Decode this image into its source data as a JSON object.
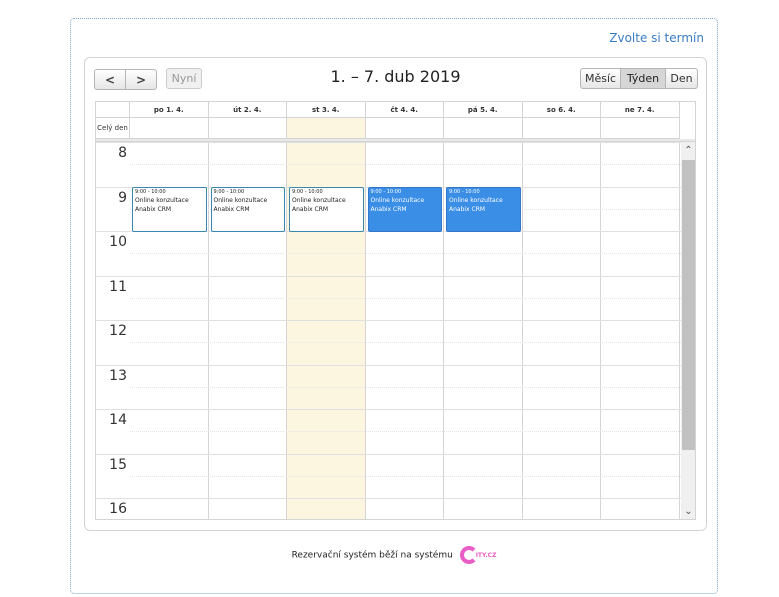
{
  "top_link": "Zvolte si termín",
  "toolbar": {
    "prev_icon": "chevron-left-icon",
    "next_icon": "chevron-right-icon",
    "today_label": "Nyní",
    "title": "1. – 7. dub 2019",
    "views": [
      "Měsíc",
      "Týden",
      "Den"
    ],
    "active_view": "Týden"
  },
  "allday_label": "Celý den",
  "days": [
    "po 1. 4.",
    "út 2. 4.",
    "st 3. 4.",
    "čt 4. 4.",
    "pá 5. 4.",
    "so 6. 4.",
    "ne 7. 4."
  ],
  "today_index": 2,
  "hours": [
    "8",
    "9",
    "10",
    "11",
    "12",
    "13",
    "14",
    "15",
    "16"
  ],
  "events": [
    {
      "day": 0,
      "time": "9:00 - 10:00",
      "title": "Online konzultace",
      "subtitle": "Anabix CRM",
      "style": "outline"
    },
    {
      "day": 1,
      "time": "9:00 - 10:00",
      "title": "Online konzultace",
      "subtitle": "Anabix CRM",
      "style": "outline"
    },
    {
      "day": 2,
      "time": "9:00 - 10:00",
      "title": "Online konzultace",
      "subtitle": "Anabix CRM",
      "style": "outline"
    },
    {
      "day": 3,
      "time": "9:00 - 10:00",
      "title": "Online konzultace",
      "subtitle": "Anabix CRM",
      "style": "filled"
    },
    {
      "day": 4,
      "time": "9:00 - 10:00",
      "title": "Online konzultace",
      "subtitle": "Anabix CRM",
      "style": "filled"
    }
  ],
  "colors": {
    "event_filled": "#3a8ee6",
    "today": "#fcf6e1",
    "link": "#3a7cc4",
    "logo": "#e85ec6"
  },
  "footer": {
    "text": "Rezervační systém běží na systému",
    "logo_text": "ITY.CZ"
  }
}
